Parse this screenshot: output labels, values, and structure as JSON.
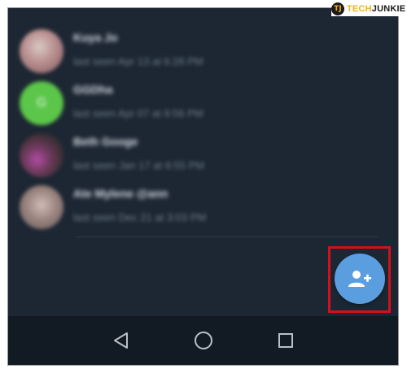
{
  "contacts": [
    {
      "name": "Kuya Jo",
      "status": "last seen Apr 13 at 6:28 PM",
      "avatar_letter": ""
    },
    {
      "name": "GGDha",
      "status": "last seen Apr 07 at 9:56 PM",
      "avatar_letter": "G"
    },
    {
      "name": "Beth Googe",
      "status": "last seen Jan 17 at 6:55 PM",
      "avatar_letter": ""
    },
    {
      "name": "Ate Mylene @ann",
      "status": "last seen Dec 21 at 3:03 PM",
      "avatar_letter": ""
    }
  ],
  "fab": {
    "icon": "add-contact-icon",
    "color": "#5b9ee0"
  },
  "highlight": {
    "color": "#d21218"
  },
  "navbar": {
    "back_icon": "back-triangle-icon",
    "home_icon": "home-circle-icon",
    "recent_icon": "recent-apps-square-icon"
  },
  "watermark": {
    "mark": "TJ",
    "part1": "TECH",
    "part2": "JUNKIE"
  }
}
